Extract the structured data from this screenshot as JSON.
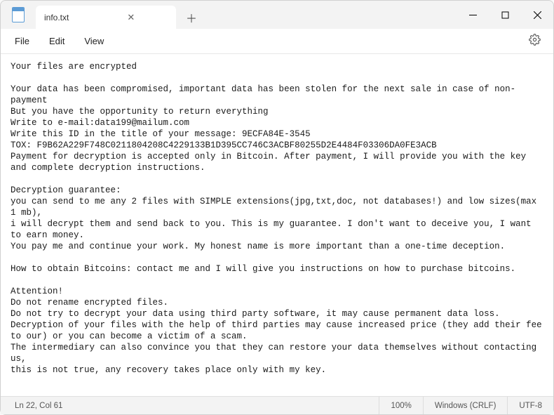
{
  "tab": {
    "title": "info.txt"
  },
  "menu": {
    "file": "File",
    "edit": "Edit",
    "view": "View"
  },
  "content": "Your files are encrypted\n\nYour data has been compromised, important data has been stolen for the next sale in case of non-payment\nBut you have the opportunity to return everything\nWrite to e-mail:data199@mailum.com\nWrite this ID in the title of your message: 9ECFA84E-3545\nTOX: F9B62A229F748C0211804208C4229133B1D395CC746C3ACBF80255D2E4484F03306DA0FE3ACB\nPayment for decryption is accepted only in Bitcoin. After payment, I will provide you with the key and complete decryption instructions.\n\nDecryption guarantee:\nyou can send to me any 2 files with SIMPLE extensions(jpg,txt,doc, not databases!) and low sizes(max 1 mb),\ni will decrypt them and send back to you. This is my guarantee. I don't want to deceive you, I want to earn money.\nYou pay me and continue your work. My honest name is more important than a one-time deception.\n\nHow to obtain Bitcoins: contact me and I will give you instructions on how to purchase bitcoins.\n\nAttention!\nDo not rename encrypted files.\nDo not try to decrypt your data using third party software, it may cause permanent data loss.\nDecryption of your files with the help of third parties may cause increased price (they add their fee to our) or you can become a victim of a scam.\nThe intermediary can also convince you that they can restore your data themselves without contacting us,\nthis is not true, any recovery takes place only with my key.",
  "statusbar": {
    "position": "Ln 22, Col 61",
    "zoom": "100%",
    "line_ending": "Windows (CRLF)",
    "encoding": "UTF-8"
  }
}
